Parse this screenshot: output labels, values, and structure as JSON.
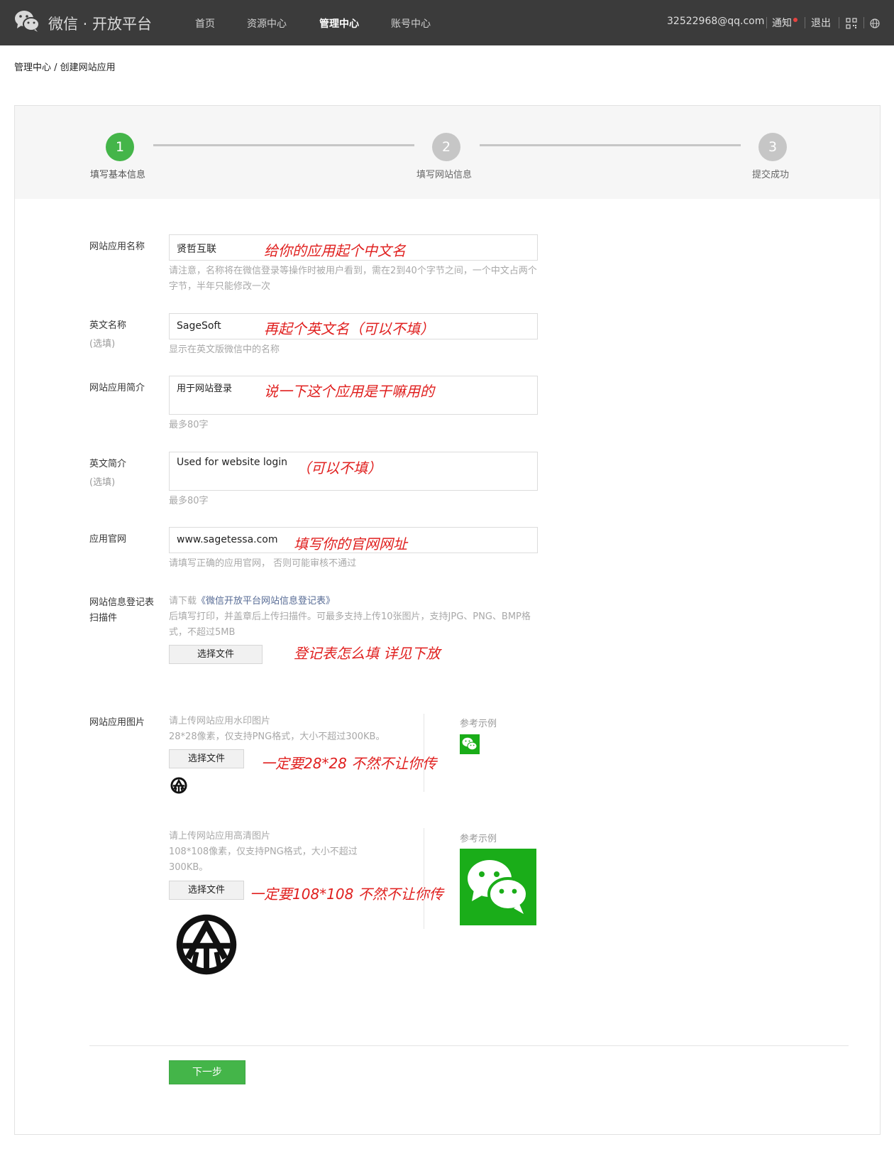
{
  "header": {
    "logo_text": "微信 · 开放平台",
    "nav": [
      "首页",
      "资源中心",
      "管理中心",
      "账号中心"
    ],
    "active_nav": "管理中心",
    "account": "32522968@qq.com",
    "notify": "通知",
    "logout": "退出"
  },
  "breadcrumb": "管理中心 / 创建网站应用",
  "steps": [
    {
      "num": "1",
      "label": "填写基本信息",
      "state": "active"
    },
    {
      "num": "2",
      "label": "填写网站信息",
      "state": "pending"
    },
    {
      "num": "3",
      "label": "提交成功",
      "state": "pending"
    }
  ],
  "colors": {
    "accent": "#44b549",
    "annotation": "#e0201f",
    "link": "#576b95"
  },
  "form": {
    "name": {
      "label": "网站应用名称",
      "value": "贤哲互联",
      "hint": "请注意，名称将在微信登录等操作时被用户看到，需在2到40个字节之间，一个中文占两个字节，半年只能修改一次",
      "annotation": "给你的应用起个中文名"
    },
    "en_name": {
      "label": "英文名称",
      "optional": "(选填)",
      "value": "SageSoft",
      "hint": "显示在英文版微信中的名称",
      "annotation": "再起个英文名（可以不填）"
    },
    "intro": {
      "label": "网站应用简介",
      "value": "用于网站登录",
      "hint": "最多80字",
      "annotation": "说一下这个应用是干嘛用的"
    },
    "en_intro": {
      "label": "英文简介",
      "optional": "(选填)",
      "value": "Used for website login",
      "hint": "最多80字",
      "annotation": "（可以不填）"
    },
    "website": {
      "label": "应用官网",
      "value": "www.sagetessa.com",
      "hint": "请填写正确的应用官网， 否则可能审核不通过",
      "annotation": "填写你的官网网址"
    },
    "registration": {
      "label_line1": "网站信息登记表",
      "label_line2": "扫描件",
      "hint_prefix": "请下载",
      "hint_link": "《微信开放平台网站信息登记表》",
      "hint_rest": "后填写打印，并盖章后上传扫描件。可最多支持上传10张图片，支持JPG、PNG、BMP格式，不超过5MB",
      "button": "选择文件",
      "annotation": "登记表怎么填 详见下放"
    },
    "app_image": {
      "label": "网站应用图片",
      "watermark": {
        "hint_title": "请上传网站应用水印图片",
        "hint_spec": "28*28像素，仅支持PNG格式，大小不超过300KB。",
        "button": "选择文件",
        "annotation": "一定要28*28 不然不让你传",
        "ref_title": "参考示例"
      },
      "hd": {
        "hint_title": "请上传网站应用高清图片",
        "hint_spec": "108*108像素，仅支持PNG格式，大小不超过300KB。",
        "button": "选择文件",
        "annotation": "一定要108*108 不然不让你传",
        "ref_title": "参考示例"
      }
    }
  },
  "next_button": "下一步"
}
